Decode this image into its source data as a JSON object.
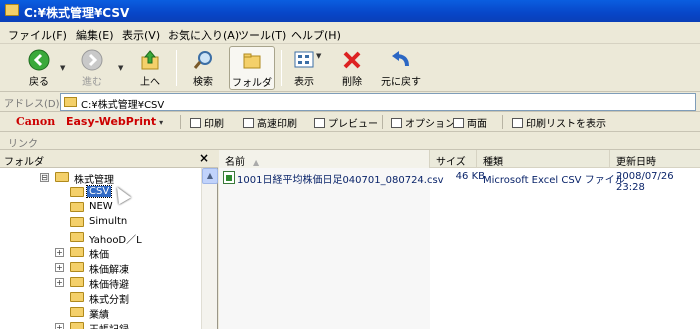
{
  "window": {
    "title": "C:¥株式管理¥CSV"
  },
  "menu": [
    "ファイル(F)",
    "編集(E)",
    "表示(V)",
    "お気に入り(A)",
    "ツール(T)",
    "ヘルプ(H)"
  ],
  "toolbar": {
    "back": "戻る",
    "forward": "進む",
    "up": "上へ",
    "search": "検索",
    "folders": "フォルダ",
    "views": "表示",
    "delete": "削除",
    "undo": "元に戻す"
  },
  "address": {
    "label": "アドレス(D)",
    "value": "C:¥株式管理¥CSV"
  },
  "canon_bar": {
    "brand": "Canon",
    "product": "Easy-WebPrint",
    "print": "印刷",
    "fast_print": "高速印刷",
    "preview": "プレビュー",
    "options": "オプション",
    "duplex": "両面",
    "print_list": "印刷リストを表示"
  },
  "links": {
    "label": "リンク"
  },
  "folders_pane": {
    "title": "フォルダ",
    "close": "×",
    "tree": [
      {
        "label": "株式管理",
        "expander": "⊟"
      },
      {
        "label": "CSV",
        "expander": ""
      },
      {
        "label": "NEW",
        "expander": ""
      },
      {
        "label": "Simultn",
        "expander": ""
      },
      {
        "label": "YahooD／L",
        "expander": ""
      },
      {
        "label": "株価",
        "expander": "+"
      },
      {
        "label": "株価解凍",
        "expander": "+"
      },
      {
        "label": "株価待避",
        "expander": "+"
      },
      {
        "label": "株式分割",
        "expander": ""
      },
      {
        "label": "業績",
        "expander": ""
      },
      {
        "label": "玉帳記録",
        "expander": "+"
      }
    ]
  },
  "files_pane": {
    "columns": {
      "name": "名前",
      "size": "サイズ",
      "type": "種類",
      "modified": "更新日時"
    },
    "rows": [
      {
        "name": "1001日経平均株価日足040701_080724.csv",
        "size": "46 KB",
        "type": "Microsoft Excel CSV ファイル",
        "modified": "2008/07/26 23:28"
      }
    ]
  }
}
